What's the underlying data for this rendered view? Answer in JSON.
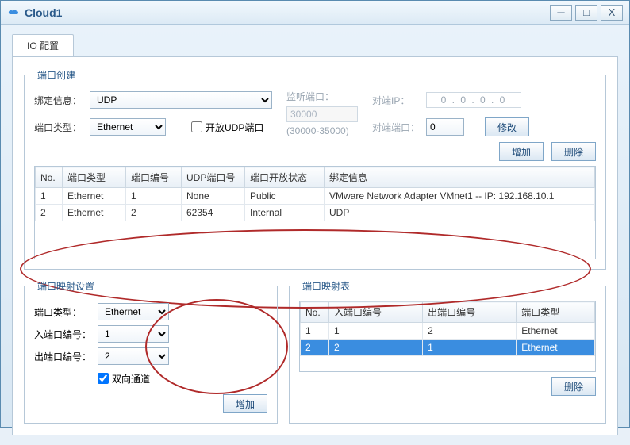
{
  "window": {
    "title": "Cloud1"
  },
  "tabs": {
    "io_config": "IO 配置"
  },
  "port_create": {
    "legend": "端口创建",
    "bind_info_label": "绑定信息：",
    "bind_info_value": "UDP",
    "port_type_label": "端口类型：",
    "port_type_value": "Ethernet",
    "open_udp_label": "开放UDP端口",
    "listen_port_label": "监听端口：",
    "listen_port_value": "30000",
    "listen_port_range": "(30000-35000)",
    "peer_ip_label": "对端IP：",
    "peer_ip_value": "0  .  0  .  0  .  0",
    "peer_port_label": "对端端口：",
    "peer_port_value": "0",
    "modify_btn": "修改",
    "add_btn": "增加",
    "del_btn": "删除"
  },
  "port_table": {
    "headers": {
      "no": "No.",
      "type": "端口类型",
      "num": "端口编号",
      "udp": "UDP端口号",
      "open": "端口开放状态",
      "bind": "绑定信息"
    },
    "rows": [
      {
        "no": "1",
        "type": "Ethernet",
        "num": "1",
        "udp": "None",
        "open": "Public",
        "bind": "VMware Network Adapter VMnet1 -- IP: 192.168.10.1"
      },
      {
        "no": "2",
        "type": "Ethernet",
        "num": "2",
        "udp": "62354",
        "open": "Internal",
        "bind": "UDP"
      }
    ]
  },
  "map_settings": {
    "legend": "端口映射设置",
    "port_type_label": "端口类型：",
    "port_type_value": "Ethernet",
    "in_port_label": "入端口编号：",
    "in_port_value": "1",
    "out_port_label": "出端口编号：",
    "out_port_value": "2",
    "bidir_label": "双向通道",
    "add_btn": "增加"
  },
  "map_table": {
    "legend": "端口映射表",
    "headers": {
      "no": "No.",
      "in": "入端口编号",
      "out": "出端口编号",
      "type": "端口类型"
    },
    "rows": [
      {
        "no": "1",
        "in": "1",
        "out": "2",
        "type": "Ethernet",
        "selected": false
      },
      {
        "no": "2",
        "in": "2",
        "out": "1",
        "type": "Ethernet",
        "selected": true
      }
    ],
    "del_btn": "删除"
  }
}
